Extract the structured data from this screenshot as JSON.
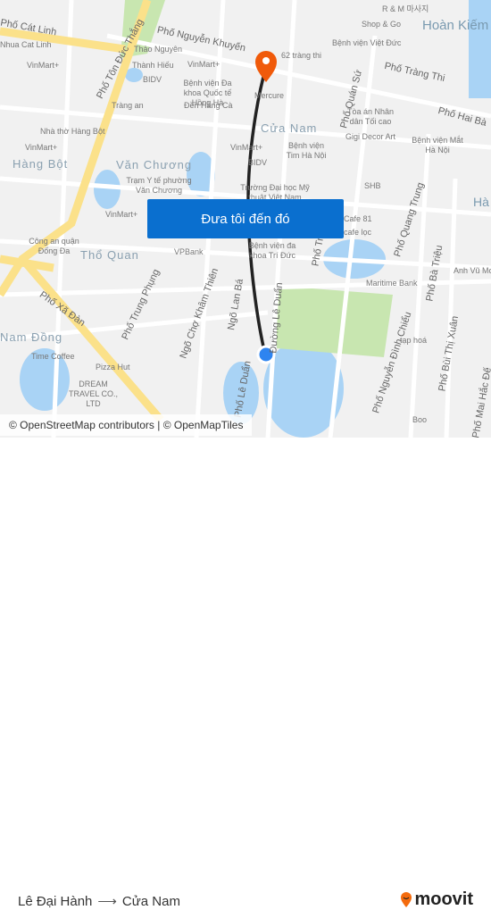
{
  "map": {
    "labels": [
      "Phố Cát Linh",
      "Phố Tôn Đức Thắng",
      "Phố Nguyễn Khuyến",
      "Thảo Nguyên",
      "Thành Hiếu",
      "BIDV",
      "VinMart+",
      "Bệnh viện Đa khoa Quốc tế Hồng Hà",
      "Tràng an",
      "Đền Hàng Cà",
      "Mercure",
      "62 tràng thi",
      "Phố Tràng Thi",
      "Phố Quán Sứ",
      "Bệnh viện Việt Đức",
      "Shop & Go",
      "R & M 마사지",
      "Tòa án Nhân dân Tối cao",
      "Gigi Decor Art",
      "Bệnh viện Mắt Hà Nội",
      "Phố Hai Bà",
      "Nhà thờ Hàng Bột",
      "VinMart+",
      "Trạm Y tế phường Văn Chương",
      "VinMart+",
      "BIDV",
      "Bệnh viện Tim Hà Nội",
      "Trường Đại học Mỹ thuật Việt Nam",
      "SHB",
      "Cafe 81",
      "cafe lọc",
      "Phố Quang Trung",
      "Công an quận Đống Đa",
      "VPBank",
      "Bệnh viện đa khoa Trí Đức",
      "Maritime Bank",
      "Anh Vũ Mo",
      "Phố Trung Phụng",
      "Ngõ Chợ Khâm Thiên",
      "Ngõ Lan Bá",
      "Đường Lê Duẩn",
      "Phố Xã Đàn",
      "Time Coffee",
      "Pizza Hut",
      "DREAM TRAVEL CO., LTD",
      "Phố Nguyễn Đình Chiểu",
      "Phố Bà Triệu",
      "Phố Bùi Thị Xuân",
      "Phố Mai Hắc Đế",
      "tạp hoá",
      "Boo",
      "Phố Trần",
      "Phố Lê Duẩn",
      "Hà",
      "VinMart+",
      "VinMart+",
      "Nhua Cat Linh"
    ],
    "districts": [
      "Hoàn Kiếm",
      "Cửa Nam",
      "Hàng Bột",
      "Văn Chương",
      "Thổ Quan",
      "Nam Đồng"
    ],
    "water_color": "#a9d3f5",
    "park_color": "#c8e6b0",
    "major_road_color": "#fbe18a",
    "route_color": "#222222",
    "origin_color": "#2e84f0",
    "destination_color": "#f05a0a"
  },
  "cta": {
    "label": "Đưa tôi đến đó"
  },
  "attribution": "© OpenStreetMap contributors | © OpenMapTiles",
  "footer": {
    "origin": "Lê Đại Hành",
    "arrow": "⟶",
    "destination": "Cửa Nam",
    "brand": "moovit"
  }
}
